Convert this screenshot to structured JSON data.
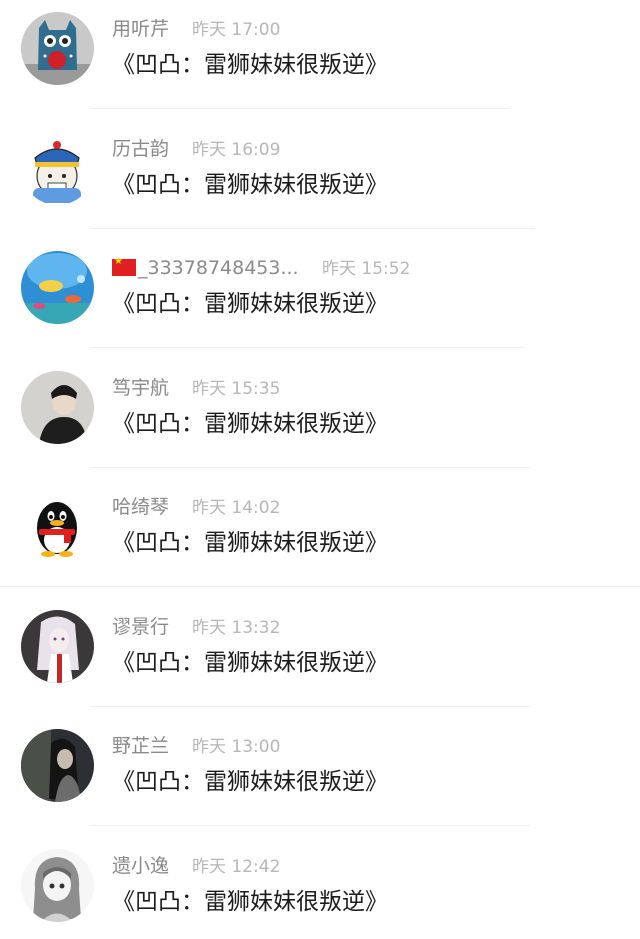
{
  "comments": [
    {
      "name": "用听芹",
      "time": "昨天 17:00",
      "message": "《凹凸：雷狮妹妹很叛逆》",
      "avatar_icon": "plush-doll-avatar-icon"
    },
    {
      "name": "历古韵",
      "time": "昨天 16:09",
      "message": "《凹凸：雷狮妹妹很叛逆》",
      "avatar_icon": "cartoon-qing-official-avatar-icon"
    },
    {
      "name": "_33378748453...",
      "name_flag_icon": "china-flag-icon",
      "time": "昨天 15:52",
      "message": "《凹凸：雷狮妹妹很叛逆》",
      "avatar_icon": "ocean-scene-avatar-icon"
    },
    {
      "name": "笃宇航",
      "time": "昨天 15:35",
      "message": "《凹凸：雷狮妹妹很叛逆》",
      "avatar_icon": "young-man-photo-avatar-icon"
    },
    {
      "name": "哈绮琴",
      "time": "昨天 14:02",
      "message": "《凹凸：雷狮妹妹很叛逆》",
      "avatar_icon": "qq-penguin-avatar-icon"
    },
    {
      "name": "谬景行",
      "time": "昨天 13:32",
      "message": "《凹凸：雷狮妹妹很叛逆》",
      "avatar_icon": "anime-girl-avatar-icon"
    },
    {
      "name": "野芷兰",
      "time": "昨天 13:00",
      "message": "《凹凸：雷狮妹妹很叛逆》",
      "avatar_icon": "dark-portrait-avatar-icon"
    },
    {
      "name": "遗小逸",
      "time": "昨天 12:42",
      "message": "《凹凸：雷狮妹妹很叛逆》",
      "avatar_icon": "sketch-anime-girl-avatar-icon"
    }
  ]
}
